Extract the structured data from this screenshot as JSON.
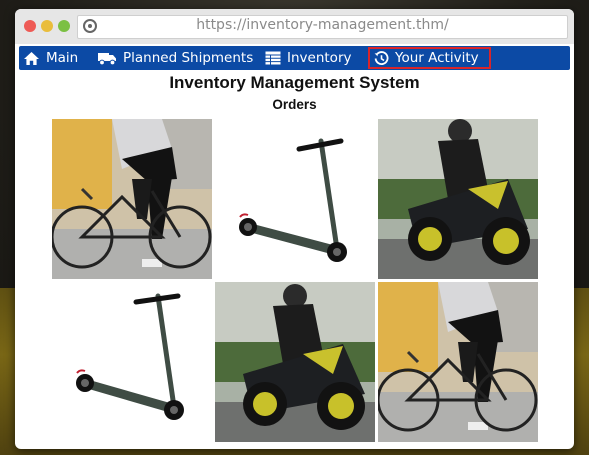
{
  "browser": {
    "url": "https://inventory-management.thm/"
  },
  "nav": {
    "items": [
      {
        "label": "Main",
        "icon": "home-icon"
      },
      {
        "label": "Planned Shipments",
        "icon": "truck-icon"
      },
      {
        "label": "Inventory",
        "icon": "table-icon"
      },
      {
        "label": "Your Activity",
        "icon": "history-icon",
        "highlighted": true
      }
    ],
    "colors": {
      "bar": "#0c4aa5",
      "highlight_border": "#d9252a"
    }
  },
  "page": {
    "title": "Inventory Management System",
    "subtitle": "Orders"
  },
  "orders": [
    {
      "product": "bicycle"
    },
    {
      "product": "electric-scooter"
    },
    {
      "product": "motorcycle"
    },
    {
      "product": "electric-scooter"
    },
    {
      "product": "motorcycle"
    },
    {
      "product": "bicycle"
    }
  ]
}
